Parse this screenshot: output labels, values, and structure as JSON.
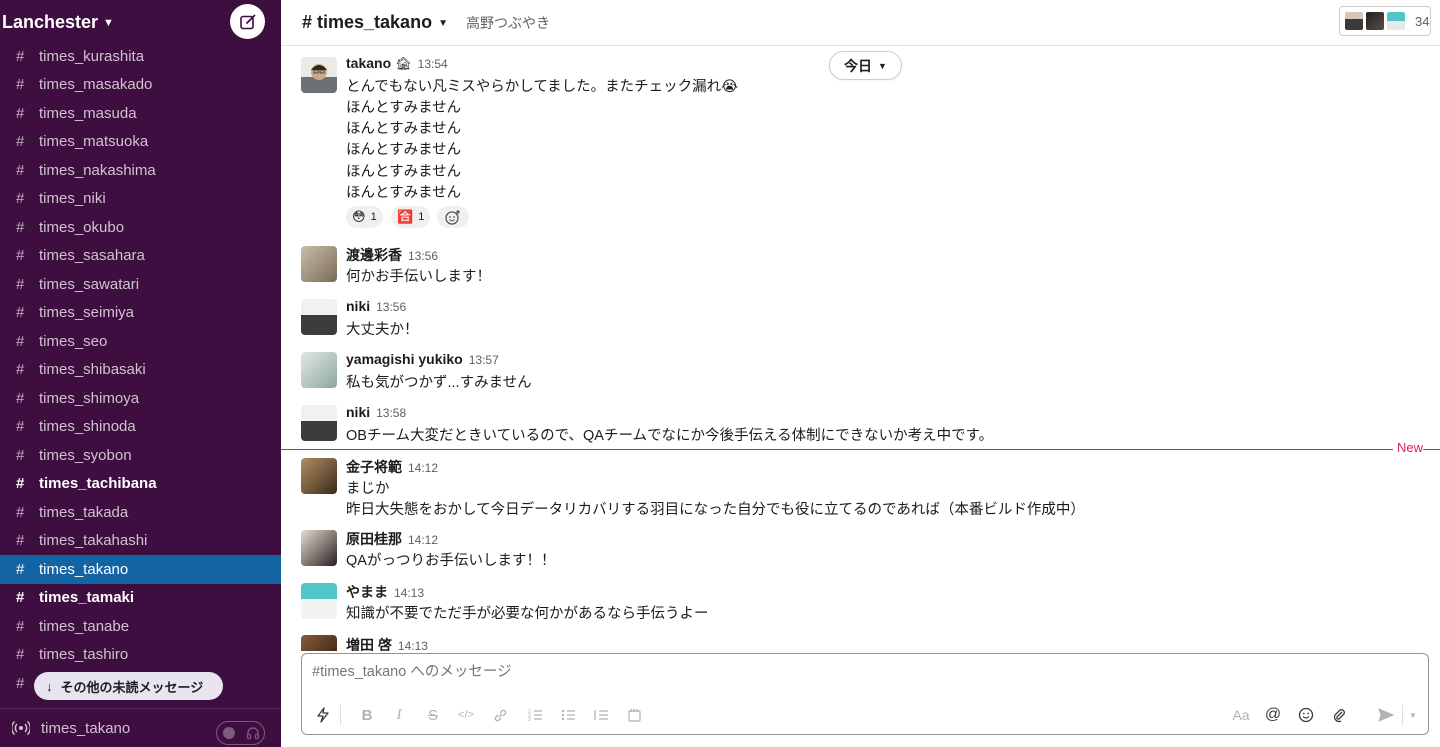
{
  "workspace": {
    "name": "Lanchester"
  },
  "sidebar": {
    "channels": [
      {
        "name": "times_kurashita",
        "state": "normal"
      },
      {
        "name": "times_masakado",
        "state": "normal"
      },
      {
        "name": "times_masuda",
        "state": "normal"
      },
      {
        "name": "times_matsuoka",
        "state": "normal"
      },
      {
        "name": "times_nakashima",
        "state": "normal"
      },
      {
        "name": "times_niki",
        "state": "normal"
      },
      {
        "name": "times_okubo",
        "state": "normal"
      },
      {
        "name": "times_sasahara",
        "state": "normal"
      },
      {
        "name": "times_sawatari",
        "state": "normal"
      },
      {
        "name": "times_seimiya",
        "state": "normal"
      },
      {
        "name": "times_seo",
        "state": "normal"
      },
      {
        "name": "times_shibasaki",
        "state": "normal"
      },
      {
        "name": "times_shimoya",
        "state": "normal"
      },
      {
        "name": "times_shinoda",
        "state": "normal"
      },
      {
        "name": "times_syobon",
        "state": "normal"
      },
      {
        "name": "times_tachibana",
        "state": "unread"
      },
      {
        "name": "times_takada",
        "state": "normal"
      },
      {
        "name": "times_takahashi",
        "state": "normal"
      },
      {
        "name": "times_takano",
        "state": "active"
      },
      {
        "name": "times_tamaki",
        "state": "unread"
      },
      {
        "name": "times_tanabe",
        "state": "normal"
      },
      {
        "name": "times_tashiro",
        "state": "normal"
      },
      {
        "name": "",
        "state": "normal"
      }
    ],
    "unread_pill": "その他の未読メッセージ",
    "huddle_channel": "times_takano"
  },
  "header": {
    "channel": "# times_takano",
    "topic": "高野つぶやき",
    "member_count": "34"
  },
  "date_divider": "今日",
  "new_divider": "New",
  "messages": [
    {
      "author": "takano",
      "status_emoji": "🏚",
      "time": "13:54",
      "lines": [
        "とんでもない凡ミスやらかしてました。またチェック漏れ😭",
        "ほんとすみません",
        "ほんとすみません",
        "ほんとすみません",
        "ほんとすみません",
        "ほんとすみません"
      ],
      "reactions": [
        {
          "emoji": "😳",
          "count": "1"
        },
        {
          "emoji": "🈴",
          "count": "1"
        }
      ]
    },
    {
      "author": "渡邊彩香",
      "time": "13:56",
      "lines": [
        "何かお手伝いします！"
      ]
    },
    {
      "author": "niki",
      "time": "13:56",
      "lines": [
        "大丈夫か！"
      ]
    },
    {
      "author": "yamagishi yukiko",
      "time": "13:57",
      "lines": [
        "私も気がつかず...すみません"
      ]
    },
    {
      "author": "niki",
      "time": "13:58",
      "lines": [
        "OBチーム大変だときいているので、QAチームでなにか今後手伝える体制にできないか考え中です。"
      ]
    },
    {
      "author": "金子将範",
      "time": "14:12",
      "lines": [
        "まじか",
        "昨日大失態をおかして今日データリカバリする羽目になった自分でも役に立てるのであれば（本番ビルド作成中）"
      ]
    },
    {
      "author": "原田桂那",
      "time": "14:12",
      "lines": [
        "QAがっつりお手伝いします！！"
      ]
    },
    {
      "author": "やまま",
      "time": "14:13",
      "lines": [
        "知識が不要でただ手が必要な何かがあるなら手伝うよー"
      ]
    },
    {
      "author": "増田 啓",
      "time": "14:13",
      "lines": []
    }
  ],
  "composer": {
    "placeholder": "#times_takano へのメッセージ",
    "format_label": "Aa",
    "mention_label": "@"
  },
  "colors": {
    "sidebar_bg": "#3f0e40",
    "active_channel": "#1264a3",
    "new_divider": "#e01e5a"
  }
}
